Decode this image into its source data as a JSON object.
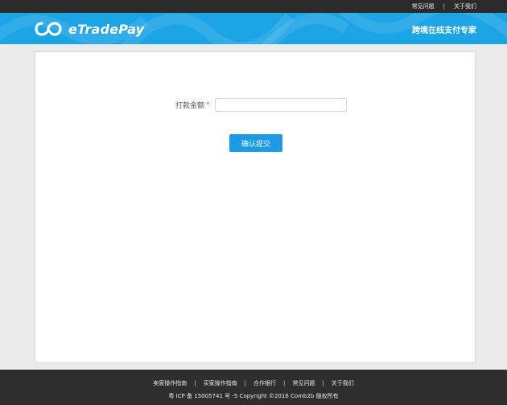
{
  "topbar": {
    "links": [
      "常见问题",
      "关于我们"
    ],
    "separator": "|"
  },
  "header": {
    "logo_text": "eTradePay",
    "logo_icon": "infinity-icon",
    "slogan": "跨境在线支付专家",
    "background_color": "#1ba4e6"
  },
  "form": {
    "amount_label": "打款金额",
    "required_mark": "*",
    "amount_value": "",
    "submit_label": "确认提交",
    "accent_color": "#1b9ae6"
  },
  "footer": {
    "links": [
      "卖家操作指南",
      "买家操作指南",
      "合作银行",
      "常见问题",
      "关于我们"
    ],
    "separator": "|",
    "copyright": "粤 ICP 备 15005741 号 -5 Copyright ©2016 Comb2b 版权所有"
  }
}
